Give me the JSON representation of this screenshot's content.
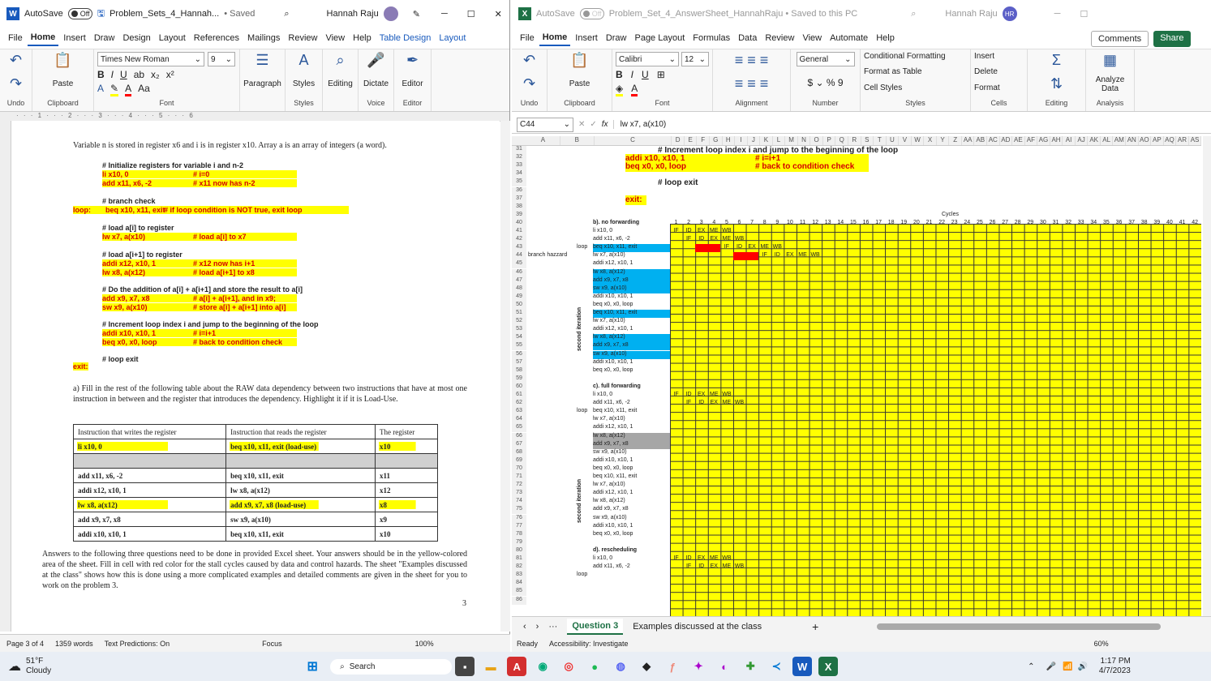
{
  "word": {
    "autosave": "AutoSave",
    "toggle": "Off",
    "title": "Problem_Sets_4_Hannah...",
    "saved": "• Saved",
    "user": "Hannah Raju",
    "menus": [
      "File",
      "Home",
      "Insert",
      "Draw",
      "Design",
      "Layout",
      "References",
      "Mailings",
      "Review",
      "View",
      "Help",
      "Table Design",
      "Layout"
    ],
    "ribbon": {
      "undo": "Undo",
      "paste": "Paste",
      "clipboard": "Clipboard",
      "font_name": "Times New Roman",
      "font_size": "9",
      "font": "Font",
      "paragraph": "Paragraph",
      "styles": "Styles",
      "editing": "Editing",
      "dictate": "Dictate",
      "voice": "Voice",
      "editor": "Editor"
    },
    "doc": {
      "intro": "Variable n is stored in register x6 and i is in register x10. Array a is an array of integers (a word).",
      "lines": [
        {
          "t": "# Initialize registers for variable i and n-2",
          "c": "",
          "hl": false
        },
        {
          "t": "li x10, 0",
          "c": "# i=0",
          "hl": true
        },
        {
          "t": "add x11, x6, -2",
          "c": "# x11 now has n-2",
          "hl": true
        },
        {
          "t": "# branch check",
          "c": "",
          "hl": false
        },
        {
          "t": "beq x10, x11, exit",
          "c": "# if loop condition is NOT true, exit loop",
          "hl": true,
          "label": "loop:"
        },
        {
          "t": "# load a[i] to register",
          "c": "",
          "hl": false
        },
        {
          "t": "lw  x7, a(x10)",
          "c": "# load a[i] to x7",
          "hl": true
        },
        {
          "t": "# load a[i+1] to register",
          "c": "",
          "hl": false
        },
        {
          "t": "addi x12, x10, 1",
          "c": "# x12 now has i+1",
          "hl": true
        },
        {
          "t": "lw  x8, a(x12)",
          "c": "# load a[i+1] to x8",
          "hl": true
        },
        {
          "t": "# Do the addition of a[i] + a[i+1] and store the result to a[i]",
          "c": "",
          "hl": false
        },
        {
          "t": "add x9, x7, x8",
          "c": "# a[i] + a[i+1], and in x9;",
          "hl": true
        },
        {
          "t": "sw x9, a(x10)",
          "c": "# store a[i] + a[i+1] into a[i]",
          "hl": true
        },
        {
          "t": "# Increment loop index i and jump to the beginning of the loop",
          "c": "",
          "hl": false
        },
        {
          "t": "addi x10, x10, 1",
          "c": "# i=i+1",
          "hl": true
        },
        {
          "t": "beq x0, x0, loop",
          "c": "# back to condition check",
          "hl": true
        },
        {
          "t": "# loop exit",
          "c": "",
          "hl": false
        }
      ],
      "exit": "exit:",
      "question": "a) Fill in the rest of the following table about the RAW data dependency between two instructions that have at most one instruction in between and the register that introduces the dependency. Highlight it if it is Load-Use.",
      "table_headers": [
        "Instruction that writes the register",
        "Instruction that reads the register",
        "The register"
      ],
      "table_rows": [
        [
          "li x10, 0",
          "beq x10, x11, exit (load-use)",
          "x10"
        ],
        [
          "",
          "",
          ""
        ],
        [
          "add x11, x6, -2",
          "beq x10, x11, exit",
          "x11"
        ],
        [
          "addi x12, x10, 1",
          "lw x8, a(x12)",
          "x12"
        ],
        [
          "lw x8, a(x12)",
          "add x9, x7, x8 (load-use)",
          "x8"
        ],
        [
          "add x9, x7, x8",
          "sw x9, a(x10)",
          "x9"
        ],
        [
          "addi x10, x10, 1",
          "beq x10, x11, exit",
          "x10"
        ]
      ],
      "answers": "Answers to the following three questions need to be done in provided Excel sheet. Your answers should be in the yellow-colored area of the sheet. Fill in cell with red color for the stall cycles caused by data and control hazards. The sheet \"Examples discussed at the class\" shows how this is done using a more complicated examples and detailed comments are given in the sheet for you to work on the problem 3.",
      "page_num": "3"
    },
    "status": {
      "page": "Page 3 of 4",
      "words": "1359 words",
      "predictions": "Text Predictions: On",
      "focus": "Focus",
      "zoom": "100%"
    }
  },
  "excel": {
    "autosave": "AutoSave",
    "toggle": "Off",
    "title": "Problem_Set_4_AnswerSheet_HannahRaju • Saved to this PC",
    "user": "Hannah Raju",
    "initials": "HR",
    "menus": [
      "File",
      "Home",
      "Insert",
      "Draw",
      "Page Layout",
      "Formulas",
      "Data",
      "Review",
      "View",
      "Automate",
      "Help"
    ],
    "comments": "Comments",
    "share": "Share",
    "ribbon": {
      "undo": "Undo",
      "paste": "Paste",
      "clipboard": "Clipboard",
      "font_name": "Calibri",
      "font_size": "12",
      "font": "Font",
      "alignment": "Alignment",
      "number_format": "General",
      "number": "Number",
      "cond": "Conditional Formatting",
      "table": "Format as Table",
      "cellstyles": "Cell Styles",
      "styles": "Styles",
      "insert": "Insert",
      "delete": "Delete",
      "format": "Format",
      "cells": "Cells",
      "editing": "Editing",
      "analyze": "Analyze Data",
      "analysis": "Analysis"
    },
    "namebox": "C44",
    "formula": "lw x7, a(x10)",
    "columns": [
      "A",
      "B",
      "C",
      "D",
      "E",
      "F",
      "G",
      "H",
      "I",
      "J",
      "K",
      "L",
      "M",
      "N",
      "O",
      "P",
      "Q",
      "R",
      "S",
      "T",
      "U",
      "V",
      "W",
      "X",
      "Y",
      "Z",
      "AA",
      "AB",
      "AC",
      "AD",
      "AE",
      "AF",
      "AG",
      "AH",
      "AI",
      "AJ",
      "AK",
      "AL",
      "AM",
      "AN",
      "AO",
      "AP",
      "AQ",
      "AR",
      "AS"
    ],
    "rows_start": 31,
    "rows_end": 86,
    "header_lines": [
      {
        "t": "# Increment loop index i and jump to the beginning of the loop",
        "row": 31
      },
      {
        "t": "addi x10, x10, 1",
        "c": "# i=i+1",
        "row": 32
      },
      {
        "t": "beq x0, x0, loop",
        "c": "# back to condition check",
        "row": 33
      },
      {
        "t": "# loop exit",
        "row": 35
      },
      {
        "t": "exit:",
        "row": 37
      }
    ],
    "cycles": "Cycles",
    "b_title": "b). no forwarding",
    "c_title": "c). full forwarding",
    "d_title": "d). rescheduling",
    "branch_hazard": "branch hazzard",
    "loop": "loop",
    "second_iter": "second iteration",
    "b_instr": [
      "li x10, 0",
      "add x11, x6, -2",
      "beq x10, x11, exit",
      "lw x7, a(x10)",
      "addi x12, x10, 1",
      "lw x8, a(x12)",
      "add x9, x7, x8",
      "sw x9, a(x10)",
      "addi x10, x10, 1",
      "beq x0, x0, loop",
      "beq x10, x11, exit",
      "lw x7, a(x10)",
      "addi x12, x10, 1",
      "lw x8, a(x12)",
      "add x9, x7, x8",
      "sw x9, a(x10)",
      "addi x10, x10, 1",
      "beq x0, x0, loop"
    ],
    "c_instr": [
      "li x10, 0",
      "add x11, x6, -2",
      "beq x10, x11, exit",
      "lw x7, a(x10)",
      "addi x12, x10, 1",
      "lw x8, a(x12)",
      "add x9, x7, x8",
      "sw x9, a(x10)",
      "addi x10, x10, 1",
      "beq x0, x0, loop",
      "beq x10, x11, exit",
      "lw x7, a(x10)",
      "addi x12, x10, 1",
      "lw x8, a(x12)",
      "add x9, x7, x8",
      "sw x9, a(x10)",
      "addi x10, x10, 1",
      "beq x0, x0, loop"
    ],
    "d_instr": [
      "li x10, 0",
      "add x11, x6, -2"
    ],
    "stages": [
      "IF",
      "ID",
      "EX",
      "ME",
      "WB"
    ],
    "tabs": [
      "Question 3",
      "Examples discussed at the class"
    ],
    "status": {
      "ready": "Ready",
      "access": "Accessibility: Investigate",
      "zoom": "60%"
    }
  },
  "taskbar": {
    "weather_temp": "51°F",
    "weather_desc": "Cloudy",
    "search": "Search",
    "time": "1:17 PM",
    "date": "4/7/2023"
  },
  "colors": {
    "word_blue": "#185abd",
    "excel_green": "#1e7145",
    "highlight": "#ffff00",
    "red": "#ff0000",
    "cyan": "#00b0f0"
  }
}
